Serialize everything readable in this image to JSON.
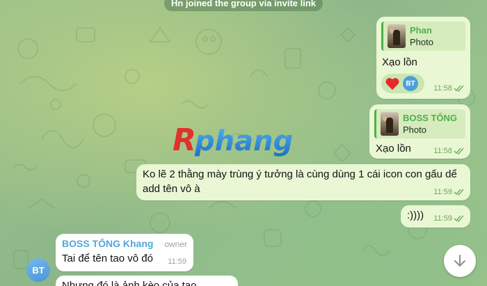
{
  "service": {
    "text": "Hn joined the group via invite link"
  },
  "messages": [
    {
      "reply": {
        "name": "Phan",
        "type": "Photo"
      },
      "text": "Xạo lồn",
      "time": "11:58",
      "reactions": {
        "emoji": "heart",
        "avatar_initials": "BT"
      }
    },
    {
      "reply": {
        "name": "BOSS TỐNG",
        "type": "Photo"
      },
      "text": "Xạo lồn",
      "time": "11:58"
    },
    {
      "text": "Ko lẽ 2 thằng mày trùng ý tưởng là cùng dùng 1 cái icon con gấu dể add tên vô à",
      "time": "11:59"
    },
    {
      "text": ":))))",
      "time": "11:59"
    },
    {
      "sender": "BOSS TỐNG Khang",
      "role": "owner",
      "text": "Tai để tên tao vô đó",
      "time": "11:59"
    },
    {
      "text": "Nhưng đó là ảnh kèo của tao"
    }
  ],
  "avatar": {
    "initials": "BT"
  },
  "watermark": {
    "text": "Rphang"
  },
  "colors": {
    "accent_green": "#4fae4e",
    "outgoing_bubble": "#eaf7d4",
    "sender_blue": "#52a7d6",
    "avatar_blue": "#4f9fd9"
  }
}
